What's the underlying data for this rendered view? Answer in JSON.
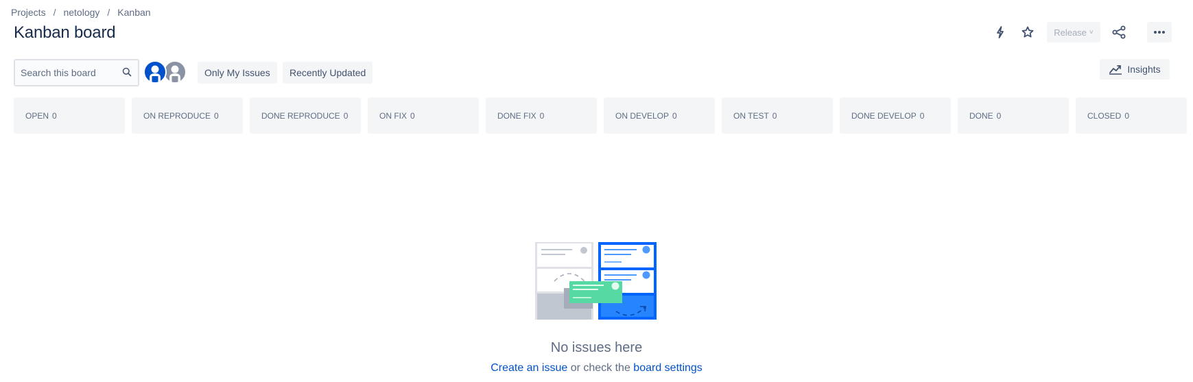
{
  "breadcrumb": {
    "projects": "Projects",
    "project": "netology",
    "board": "Kanban",
    "sep": "/"
  },
  "page": {
    "title": "Kanban board"
  },
  "actions": {
    "release_label": "Release",
    "release_chevron": "˅"
  },
  "search": {
    "placeholder": "Search this board"
  },
  "filters": {
    "only_my_issues": "Only My Issues",
    "recently_updated": "Recently Updated"
  },
  "insights": {
    "label": "Insights"
  },
  "columns": [
    {
      "name": "OPEN",
      "count": "0"
    },
    {
      "name": "ON REPRODUCE",
      "count": "0"
    },
    {
      "name": "DONE REPRODUCE",
      "count": "0"
    },
    {
      "name": "ON FIX",
      "count": "0"
    },
    {
      "name": "DONE FIX",
      "count": "0"
    },
    {
      "name": "ON DEVELOP",
      "count": "0"
    },
    {
      "name": "ON TEST",
      "count": "0"
    },
    {
      "name": "DONE DEVELOP",
      "count": "0"
    },
    {
      "name": "DONE",
      "count": "0"
    },
    {
      "name": "CLOSED",
      "count": "0"
    }
  ],
  "empty_state": {
    "message": "No issues here",
    "create_link": "Create an issue",
    "middle_text": " or check the ",
    "settings_link": "board settings"
  },
  "colors": {
    "accent": "#0052cc",
    "illustration_blue": "#1d7afc",
    "illustration_green": "#57d9a3"
  },
  "icons": [
    "lightning-icon",
    "star-icon",
    "chevron-down-icon",
    "share-icon",
    "more-icon",
    "search-icon",
    "chart-line-icon",
    "avatar-icon"
  ]
}
